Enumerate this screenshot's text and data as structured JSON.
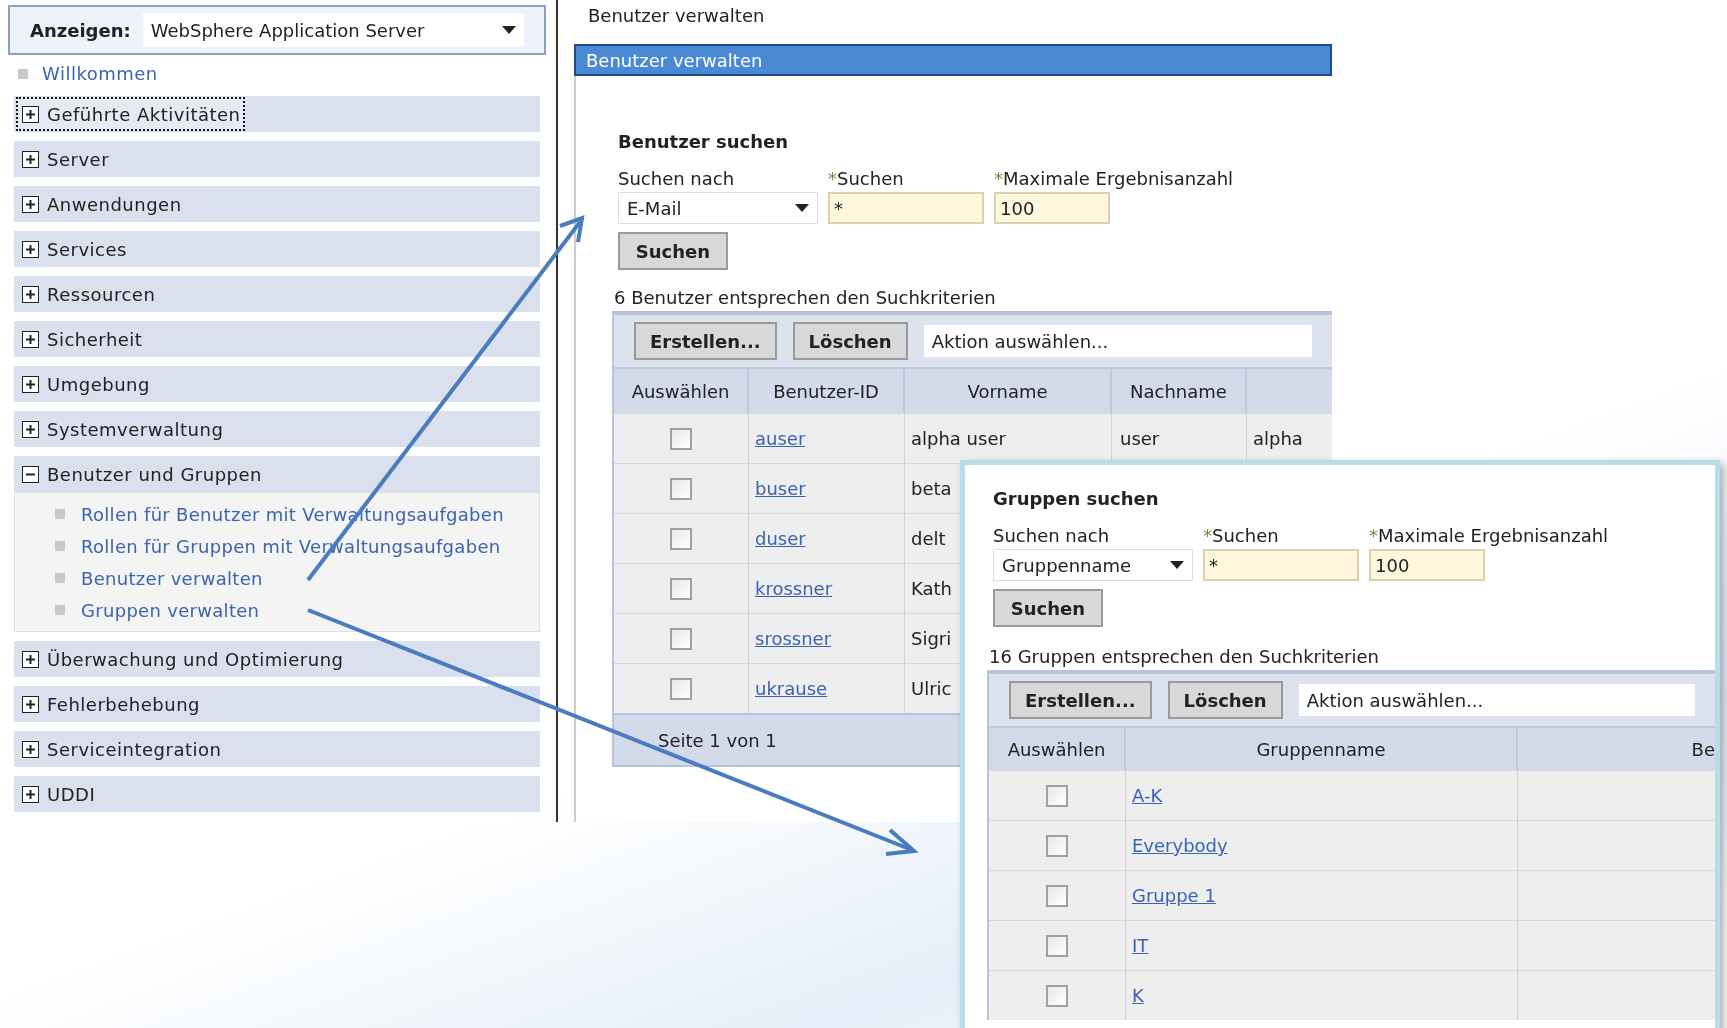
{
  "nav": {
    "view_label": "Anzeigen:",
    "view_value": "WebSphere Application Server",
    "welcome": "Willkommen",
    "items": [
      {
        "label": "Geführte Aktivitäten",
        "expanded": false,
        "focused": true
      },
      {
        "label": "Server",
        "expanded": false,
        "focused": false
      },
      {
        "label": "Anwendungen",
        "expanded": false,
        "focused": false
      },
      {
        "label": "Services",
        "expanded": false,
        "focused": false
      },
      {
        "label": "Ressourcen",
        "expanded": false,
        "focused": false
      },
      {
        "label": "Sicherheit",
        "expanded": false,
        "focused": false
      },
      {
        "label": "Umgebung",
        "expanded": false,
        "focused": false
      },
      {
        "label": "Systemverwaltung",
        "expanded": false,
        "focused": false
      },
      {
        "label": "Benutzer und Gruppen",
        "expanded": true,
        "focused": false,
        "children": [
          "Rollen für Benutzer mit Verwaltungsaufgaben",
          "Rollen für Gruppen mit Verwaltungsaufgaben",
          "Benutzer verwalten",
          "Gruppen verwalten"
        ]
      },
      {
        "label": "Überwachung und Optimierung",
        "expanded": false,
        "focused": false
      },
      {
        "label": "Fehlerbehebung",
        "expanded": false,
        "focused": false
      },
      {
        "label": "Serviceintegration",
        "expanded": false,
        "focused": false
      },
      {
        "label": "UDDI",
        "expanded": false,
        "focused": false
      }
    ]
  },
  "users": {
    "breadcrumb": "Benutzer verwalten",
    "title": "Benutzer verwalten",
    "heading": "Benutzer suchen",
    "search_by_label": "Suchen nach",
    "search_by_value": "E-Mail",
    "search_label": "Suchen",
    "search_value": "*",
    "max_label": "Maximale Ergebnisanzahl",
    "max_value": "100",
    "search_button": "Suchen",
    "result_text": "6 Benutzer entsprechen den Suchkriterien",
    "buttons": [
      "Erstellen...",
      "Löschen"
    ],
    "action_placeholder": "Aktion auswählen...",
    "columns": [
      "Auswählen",
      "Benutzer-ID",
      "Vorname",
      "Nachname"
    ],
    "rows": [
      {
        "checked": false,
        "id": "auser",
        "first": "alpha user",
        "last": "user",
        "column_5": "alpha"
      },
      {
        "checked": false,
        "id": "buser",
        "first": "beta"
      },
      {
        "checked": false,
        "id": "duser",
        "first": "delt"
      },
      {
        "checked": false,
        "id": "krossner",
        "first": "Kath"
      },
      {
        "checked": false,
        "id": "srossner",
        "first": "Sigri"
      },
      {
        "checked": false,
        "id": "ukrause",
        "first": "Ulric"
      }
    ],
    "footer": "Seite 1 von 1"
  },
  "groups": {
    "heading": "Gruppen suchen",
    "search_by_label": "Suchen nach",
    "search_by_value": "Gruppenname",
    "search_label": "Suchen",
    "search_value": "*",
    "max_label": "Maximale Ergebnisanzahl",
    "max_value": "100",
    "search_button": "Suchen",
    "result_text": "16 Gruppen entsprechen den Suchkriterien",
    "buttons": [
      "Erstellen...",
      "Löschen"
    ],
    "action_placeholder": "Aktion auswählen...",
    "columns": [
      "Auswählen",
      "Gruppenname",
      "Be"
    ],
    "rows": [
      {
        "checked": false,
        "name": "A-K"
      },
      {
        "checked": false,
        "name": "Everybody"
      },
      {
        "checked": false,
        "name": "Gruppe 1"
      },
      {
        "checked": false,
        "name": "IT"
      },
      {
        "checked": false,
        "name": "K"
      }
    ]
  }
}
